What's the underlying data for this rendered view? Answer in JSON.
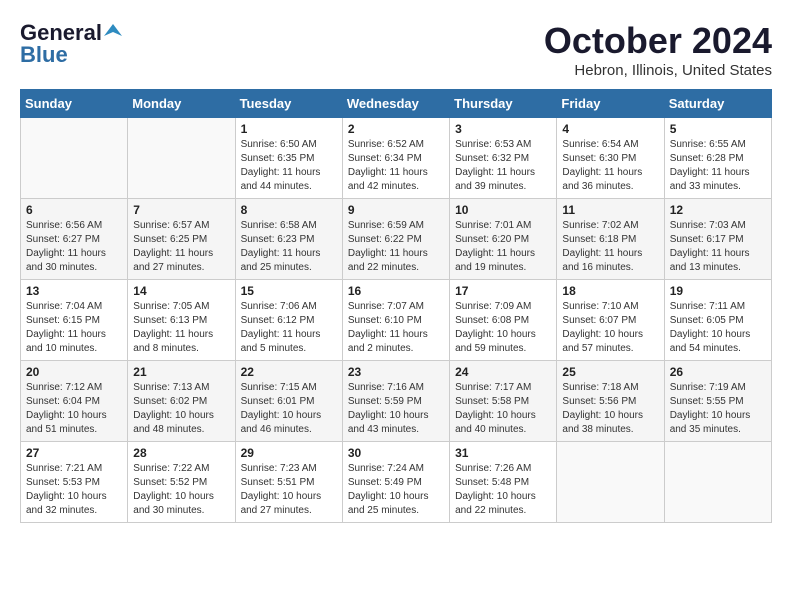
{
  "logo": {
    "line1": "General",
    "line2": "Blue"
  },
  "title": "October 2024",
  "location": "Hebron, Illinois, United States",
  "days_of_week": [
    "Sunday",
    "Monday",
    "Tuesday",
    "Wednesday",
    "Thursday",
    "Friday",
    "Saturday"
  ],
  "weeks": [
    [
      {
        "day": "",
        "info": ""
      },
      {
        "day": "",
        "info": ""
      },
      {
        "day": "1",
        "sunrise": "6:50 AM",
        "sunset": "6:35 PM",
        "daylight": "11 hours and 44 minutes."
      },
      {
        "day": "2",
        "sunrise": "6:52 AM",
        "sunset": "6:34 PM",
        "daylight": "11 hours and 42 minutes."
      },
      {
        "day": "3",
        "sunrise": "6:53 AM",
        "sunset": "6:32 PM",
        "daylight": "11 hours and 39 minutes."
      },
      {
        "day": "4",
        "sunrise": "6:54 AM",
        "sunset": "6:30 PM",
        "daylight": "11 hours and 36 minutes."
      },
      {
        "day": "5",
        "sunrise": "6:55 AM",
        "sunset": "6:28 PM",
        "daylight": "11 hours and 33 minutes."
      }
    ],
    [
      {
        "day": "6",
        "sunrise": "6:56 AM",
        "sunset": "6:27 PM",
        "daylight": "11 hours and 30 minutes."
      },
      {
        "day": "7",
        "sunrise": "6:57 AM",
        "sunset": "6:25 PM",
        "daylight": "11 hours and 27 minutes."
      },
      {
        "day": "8",
        "sunrise": "6:58 AM",
        "sunset": "6:23 PM",
        "daylight": "11 hours and 25 minutes."
      },
      {
        "day": "9",
        "sunrise": "6:59 AM",
        "sunset": "6:22 PM",
        "daylight": "11 hours and 22 minutes."
      },
      {
        "day": "10",
        "sunrise": "7:01 AM",
        "sunset": "6:20 PM",
        "daylight": "11 hours and 19 minutes."
      },
      {
        "day": "11",
        "sunrise": "7:02 AM",
        "sunset": "6:18 PM",
        "daylight": "11 hours and 16 minutes."
      },
      {
        "day": "12",
        "sunrise": "7:03 AM",
        "sunset": "6:17 PM",
        "daylight": "11 hours and 13 minutes."
      }
    ],
    [
      {
        "day": "13",
        "sunrise": "7:04 AM",
        "sunset": "6:15 PM",
        "daylight": "11 hours and 10 minutes."
      },
      {
        "day": "14",
        "sunrise": "7:05 AM",
        "sunset": "6:13 PM",
        "daylight": "11 hours and 8 minutes."
      },
      {
        "day": "15",
        "sunrise": "7:06 AM",
        "sunset": "6:12 PM",
        "daylight": "11 hours and 5 minutes."
      },
      {
        "day": "16",
        "sunrise": "7:07 AM",
        "sunset": "6:10 PM",
        "daylight": "11 hours and 2 minutes."
      },
      {
        "day": "17",
        "sunrise": "7:09 AM",
        "sunset": "6:08 PM",
        "daylight": "10 hours and 59 minutes."
      },
      {
        "day": "18",
        "sunrise": "7:10 AM",
        "sunset": "6:07 PM",
        "daylight": "10 hours and 57 minutes."
      },
      {
        "day": "19",
        "sunrise": "7:11 AM",
        "sunset": "6:05 PM",
        "daylight": "10 hours and 54 minutes."
      }
    ],
    [
      {
        "day": "20",
        "sunrise": "7:12 AM",
        "sunset": "6:04 PM",
        "daylight": "10 hours and 51 minutes."
      },
      {
        "day": "21",
        "sunrise": "7:13 AM",
        "sunset": "6:02 PM",
        "daylight": "10 hours and 48 minutes."
      },
      {
        "day": "22",
        "sunrise": "7:15 AM",
        "sunset": "6:01 PM",
        "daylight": "10 hours and 46 minutes."
      },
      {
        "day": "23",
        "sunrise": "7:16 AM",
        "sunset": "5:59 PM",
        "daylight": "10 hours and 43 minutes."
      },
      {
        "day": "24",
        "sunrise": "7:17 AM",
        "sunset": "5:58 PM",
        "daylight": "10 hours and 40 minutes."
      },
      {
        "day": "25",
        "sunrise": "7:18 AM",
        "sunset": "5:56 PM",
        "daylight": "10 hours and 38 minutes."
      },
      {
        "day": "26",
        "sunrise": "7:19 AM",
        "sunset": "5:55 PM",
        "daylight": "10 hours and 35 minutes."
      }
    ],
    [
      {
        "day": "27",
        "sunrise": "7:21 AM",
        "sunset": "5:53 PM",
        "daylight": "10 hours and 32 minutes."
      },
      {
        "day": "28",
        "sunrise": "7:22 AM",
        "sunset": "5:52 PM",
        "daylight": "10 hours and 30 minutes."
      },
      {
        "day": "29",
        "sunrise": "7:23 AM",
        "sunset": "5:51 PM",
        "daylight": "10 hours and 27 minutes."
      },
      {
        "day": "30",
        "sunrise": "7:24 AM",
        "sunset": "5:49 PM",
        "daylight": "10 hours and 25 minutes."
      },
      {
        "day": "31",
        "sunrise": "7:26 AM",
        "sunset": "5:48 PM",
        "daylight": "10 hours and 22 minutes."
      },
      {
        "day": "",
        "info": ""
      },
      {
        "day": "",
        "info": ""
      }
    ]
  ]
}
